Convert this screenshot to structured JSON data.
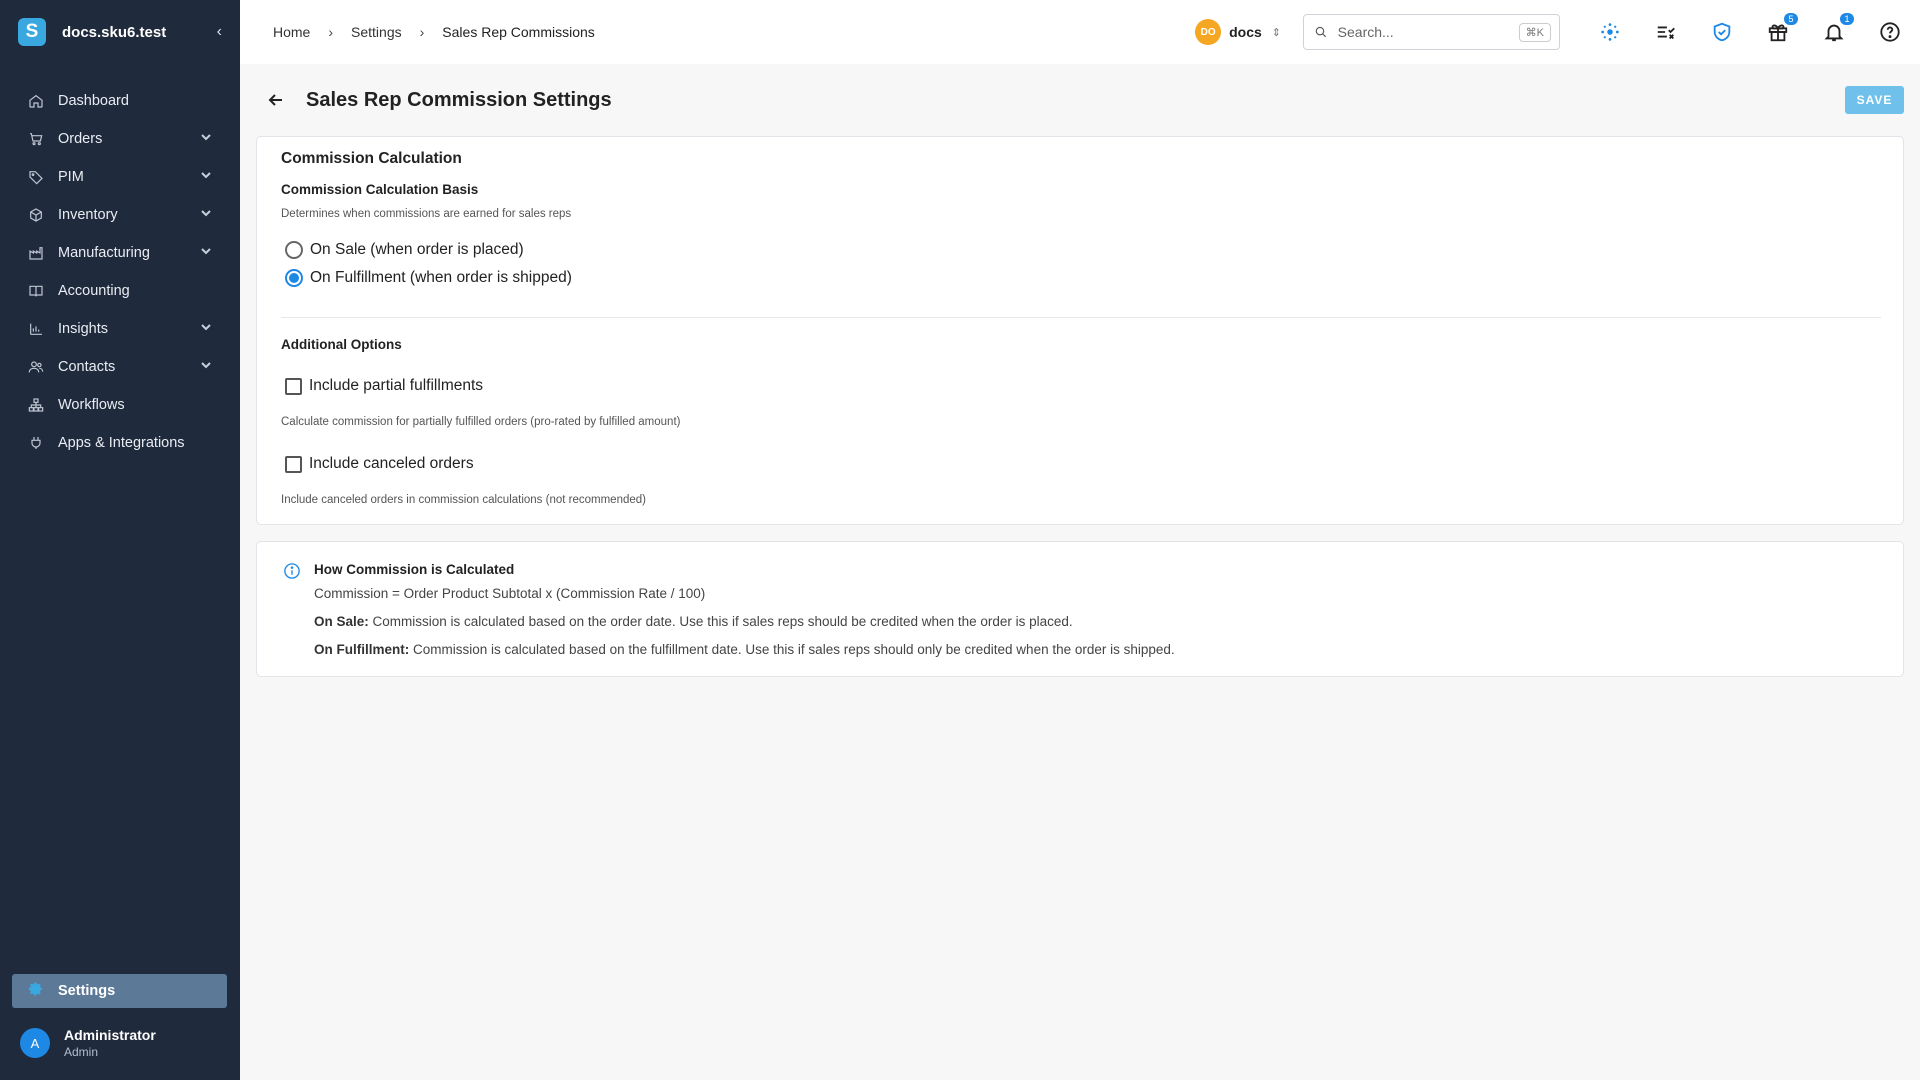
{
  "sidebar": {
    "brand": {
      "logo_letter": "S",
      "name": "docs.sku6.test",
      "collapse_glyph": "‹"
    },
    "items": [
      {
        "label": "Dashboard",
        "icon": "home-icon",
        "has_children": false
      },
      {
        "label": "Orders",
        "icon": "cart-icon",
        "has_children": true
      },
      {
        "label": "PIM",
        "icon": "tag-icon",
        "has_children": true
      },
      {
        "label": "Inventory",
        "icon": "box-icon",
        "has_children": true
      },
      {
        "label": "Manufacturing",
        "icon": "factory-icon",
        "has_children": true
      },
      {
        "label": "Accounting",
        "icon": "ledger-icon",
        "has_children": false
      },
      {
        "label": "Insights",
        "icon": "bar-chart-icon",
        "has_children": true
      },
      {
        "label": "Contacts",
        "icon": "people-icon",
        "has_children": true
      },
      {
        "label": "Workflows",
        "icon": "hierarchy-icon",
        "has_children": false
      },
      {
        "label": "Apps & Integrations",
        "icon": "plug-icon",
        "has_children": false
      }
    ],
    "settings_label": "Settings",
    "user": {
      "initial": "A",
      "name": "Administrator",
      "role": "Admin"
    }
  },
  "topbar": {
    "breadcrumb": [
      "Home",
      "Settings",
      "Sales Rep Commissions"
    ],
    "breadcrumb_sep": "›",
    "org": {
      "badge": "DO",
      "name": "docs",
      "chevron": "⌃⌄"
    },
    "search": {
      "placeholder": "Search...",
      "shortcut": "⌘K"
    },
    "badges": {
      "gifts": "5",
      "notifications": "1"
    }
  },
  "page": {
    "title": "Sales Rep Commission Settings",
    "save_label": "SAVE"
  },
  "commission": {
    "section_title": "Commission Calculation",
    "basis_label": "Commission Calculation Basis",
    "basis_help": "Determines when commissions are earned for sales reps",
    "options": [
      {
        "label": "On Sale (when order is placed)",
        "selected": false
      },
      {
        "label": "On Fulfillment (when order is shipped)",
        "selected": true
      }
    ],
    "additional_label": "Additional Options",
    "partial": {
      "label": "Include partial fulfillments",
      "help": "Calculate commission for partially fulfilled orders (pro-rated by fulfilled amount)",
      "checked": false
    },
    "canceled": {
      "label": "Include canceled orders",
      "help": "Include canceled orders in commission calculations (not recommended)",
      "checked": false
    }
  },
  "info": {
    "title": "How Commission is Calculated",
    "formula": "Commission = Order Product Subtotal x (Commission Rate / 100)",
    "on_sale_label": "On Sale:",
    "on_sale_text": " Commission is calculated based on the order date. Use this if sales reps should be credited when the order is placed.",
    "on_fulfillment_label": "On Fulfillment:",
    "on_fulfillment_text": " Commission is calculated based on the fulfillment date. Use this if sales reps should only be credited when the order is shipped."
  },
  "colors": {
    "sidebar_bg": "#1f2a3c",
    "accent": "#1e88e5",
    "save_bg": "#6fc0ea",
    "org_badge": "#f5a623"
  }
}
